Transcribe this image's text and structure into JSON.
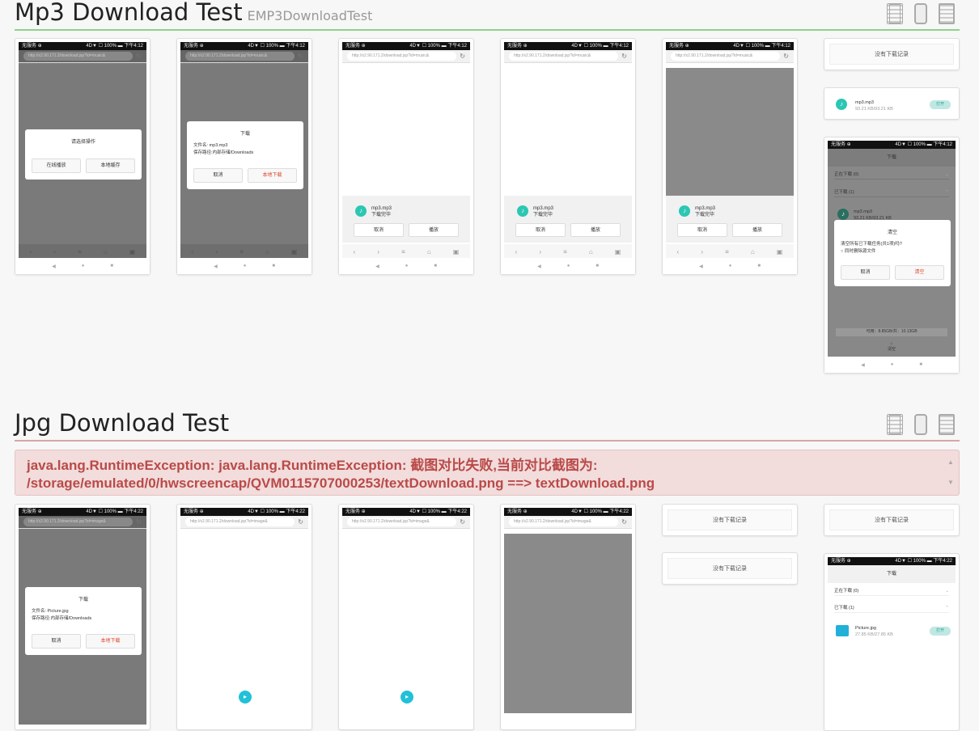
{
  "mp3": {
    "title": "Mp3 Download Test",
    "subtitle": "EMP3DownloadTest",
    "status": {
      "left": "无服务 ⊕",
      "right": "4D▼ ☐ 100% ▬ 下午4:12"
    },
    "url1": "http://x2.90.171.2/download.jsp?id=music&",
    "dialog_choose": {
      "title": "请选择操作",
      "online": "在线播放",
      "cache": "本地缓存"
    },
    "dialog_download": {
      "title": "下载",
      "filename": "文件名: mp3.mp3",
      "path": "保存路径:内部存储/Downloads",
      "cancel": "取消",
      "local": "本地下载"
    },
    "complete": {
      "file": "mp3.mp3",
      "state": "下载完毕",
      "cancel": "取消",
      "play": "播放"
    },
    "no_record": "没有下载记录",
    "item": {
      "name": "mp3.mp3",
      "size": "93.21 KB/93.21 KB",
      "open": "打开"
    },
    "manager": {
      "title": "下载",
      "downloading": "正在下载 (0)",
      "downloaded": "已下载 (1)",
      "clear_title": "清空",
      "clear_question": "清空所有已下载任务(共1项)吗?",
      "delete_files": "同时删除源文件",
      "cancel": "取消",
      "confirm": "清空",
      "storage": "可用：8.85GB/共：10.13GB",
      "clear_label": "清空"
    }
  },
  "jpg": {
    "title": "Jpg Download Test",
    "status": {
      "left": "无服务 ⊕",
      "right": "4D▼ ☐ 100% ▬ 下午4:22"
    },
    "url": "http://x2.90.171.2/download.jsp?id=image&",
    "error_line1": "java.lang.RuntimeException: java.lang.RuntimeException: 截图对比失败,当前对比截图为:",
    "error_line2": "/storage/emulated/0/hwscreencap/QVM0115707000253/textDownload.png ==> textDownload.png",
    "dialog_download": {
      "title": "下载",
      "filename": "文件名: Picture.jpg",
      "path": "保存路径:内部存储/Downloads",
      "cancel": "取消",
      "local": "本地下载"
    },
    "no_record": "没有下载记录",
    "manager": {
      "title": "下载",
      "downloading": "正在下载 (0)",
      "downloaded": "已下载 (1)",
      "item_name": "Picture.jpg",
      "item_size": "27.85 KB/27.85 KB",
      "open": "打开"
    }
  },
  "icons": {
    "film": "film-view-icon",
    "phone": "phone-view-icon",
    "list": "list-view-icon"
  },
  "colors": {
    "accent_green": "#8fd18f",
    "error_red": "#b94a48",
    "teal": "#2bc7b3"
  }
}
